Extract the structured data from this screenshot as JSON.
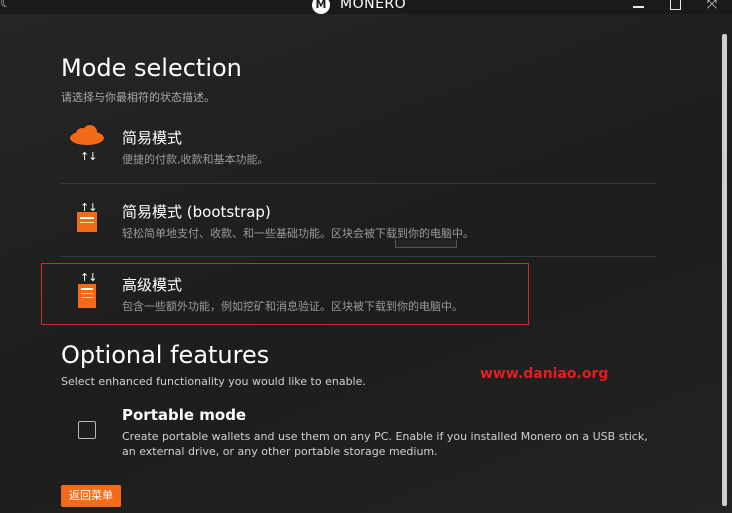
{
  "titlebar": {
    "logo_letter": "M",
    "title": "MONERO",
    "moon_glyph": "☾",
    "close_glyph": "⤧"
  },
  "colors": {
    "accent": "#f36b19",
    "selection_border": "#d42a2a",
    "watermark": "#e02020"
  },
  "mode_section": {
    "title": "Mode selection",
    "subtitle": "请选择与你最相符的状态描述。",
    "options": [
      {
        "title": "简易模式",
        "description": "便捷的付款,收款和基本功能。",
        "icon": "cloud-icon",
        "selected": false
      },
      {
        "title": "简易模式 (bootstrap)",
        "description": "轻松简单地支付、收款、和一些基础功能。区块会被下载到你的电脑中。",
        "icon": "node-small-icon",
        "selected": false
      },
      {
        "title": "高级模式",
        "description": "包含一些额外功能，例如挖矿和消息验证。区块被下载到你的电脑中。",
        "icon": "node-large-icon",
        "selected": true
      }
    ]
  },
  "features_section": {
    "title": "Optional features",
    "subtitle": "Select enhanced functionality you would like to enable.",
    "portable": {
      "title": "Portable mode",
      "description": "Create portable wallets and use them on any PC. Enable if you installed Monero on a USB stick, an external drive, or any other portable storage medium.",
      "checked": false
    }
  },
  "back_button": {
    "label": "返回菜单"
  },
  "watermark": {
    "text": "www.daniao.org"
  },
  "arrows_glyph": "↑↓"
}
